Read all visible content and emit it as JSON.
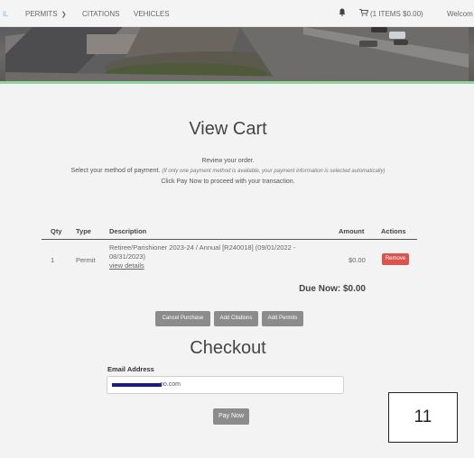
{
  "nav": {
    "left_fragment": "iL",
    "permits_label": "PERMITS",
    "citations_label": "CITATIONS",
    "vehicles_label": "VEHICLES",
    "cart_label": "(1 ITEMS $0.00)",
    "welcome_label": "Welcom"
  },
  "page": {
    "title": "View Cart",
    "instr1": "Review your order.",
    "instr2_main": "Select your method of payment.",
    "instr2_note": "(If only one payment method is available, your payment information is selected automatically)",
    "instr3": "Click Pay Now to proceed with your transaction."
  },
  "table": {
    "headers": {
      "qty": "Qty",
      "type": "Type",
      "description": "Description",
      "amount": "Amount",
      "actions": "Actions"
    },
    "rows": [
      {
        "qty": "1",
        "type": "Permit",
        "description_line1": "Retiree/Parishioner 2023-24 / Annual [R240018] (09/01/2022 -",
        "description_line2": "08/31/2023)",
        "view_details": "view details",
        "amount": "$0.00",
        "remove_label": "Remove"
      }
    ]
  },
  "due_now": "Due Now: $0.00",
  "buttons": {
    "cancel": "Cancel Purchase",
    "add_citations": "Add Citations",
    "add_permits": "Add Permits",
    "pay_now": "Pay Now"
  },
  "checkout": {
    "title": "Checkout",
    "email_label": "Email Address",
    "email_value": "no.com"
  },
  "annotation_box": "11",
  "colors": {
    "accent_bar": "#8fd29b",
    "remove": "#d9534f",
    "button_gray": "#8c8c8c",
    "redaction": "#1a1a8c"
  }
}
